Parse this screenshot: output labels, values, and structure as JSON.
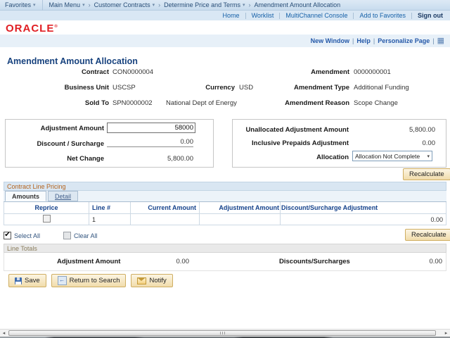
{
  "icons": {
    "dropdown": "▾",
    "separator": "›",
    "window_grid": "▦",
    "check": "✔",
    "left_arrow": "◂",
    "right_arrow": "▸"
  },
  "colors": {
    "oracle_red": "#e01e23",
    "link_blue": "#1661a8",
    "title_navy": "#17427e",
    "section_orange": "#b4641e",
    "button_cream": "#f1dcab"
  },
  "nav": {
    "favorites": "Favorites",
    "main_menu": "Main Menu",
    "crumb2": "Customer Contracts",
    "crumb3": "Determine Price and Terms",
    "crumb4": "Amendment Amount Allocation"
  },
  "header_links": {
    "home": "Home",
    "worklist": "Worklist",
    "multichannel": "MultiChannel Console",
    "add_to_favorites": "Add to Favorites",
    "sign_out": "Sign out"
  },
  "brand": {
    "name": "ORACLE",
    "reg": "®"
  },
  "page_links": {
    "new_window": "New Window",
    "help": "Help",
    "personalize": "Personalize Page"
  },
  "page": {
    "title": "Amendment Amount Allocation",
    "info": {
      "contract_label": "Contract",
      "contract": "CON0000004",
      "amendment_label": "Amendment",
      "amendment": "0000000001",
      "business_unit_label": "Business Unit",
      "business_unit": "USCSP",
      "currency_label": "Currency",
      "currency": "USD",
      "amendment_type_label": "Amendment Type",
      "amendment_type": "Additional Funding",
      "sold_to_label": "Sold To",
      "sold_to": "SPN0000002",
      "sold_to_name": "National Dept of Energy",
      "amendment_reason_label": "Amendment Reason",
      "amendment_reason": "Scope Change"
    },
    "adjustment_box": {
      "adjustment_amount_label": "Adjustment Amount",
      "adjustment_amount_value": "58000",
      "discount_surcharge_label": "Discount / Surcharge",
      "discount_surcharge_value": "0.00",
      "net_change_label": "Net Change",
      "net_change_value": "5,800.00"
    },
    "allocation_box": {
      "unallocated_label": "Unallocated Adjustment Amount",
      "unallocated_value": "5,800.00",
      "inclusive_label": "Inclusive Prepaids Adjustment",
      "inclusive_value": "0.00",
      "allocation_label": "Allocation",
      "allocation_value": "Allocation Not Complete"
    },
    "recalculate_label": "Recalculate",
    "grid": {
      "title": "Contract Line Pricing",
      "tabs": [
        "Amounts",
        "Detail"
      ],
      "columns": [
        "Reprice",
        "Line #",
        "Current Amount",
        "Adjustment Amount",
        "Discount/Surcharge Adjustment"
      ],
      "rows": [
        {
          "line": "1",
          "current_amount": "",
          "adjustment_amount": "",
          "discount_adjustment": "0.00"
        }
      ],
      "select_all": "Select All",
      "clear_all": "Clear All"
    },
    "line_totals": {
      "title": "Line Totals",
      "adjustment_amount_label": "Adjustment Amount",
      "adjustment_amount_value": "0.00",
      "discounts_label": "Discounts/Surcharges",
      "discounts_value": "0.00"
    },
    "actions": {
      "save": "Save",
      "return_to_search": "Return to Search",
      "notify": "Notify"
    }
  }
}
